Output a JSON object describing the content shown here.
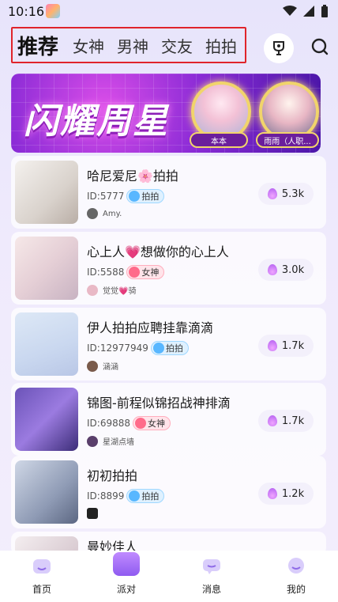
{
  "status_bar": {
    "time": "10:16"
  },
  "tabs": [
    {
      "label": "推荐",
      "active": true
    },
    {
      "label": "女神",
      "active": false
    },
    {
      "label": "男神",
      "active": false
    },
    {
      "label": "交友",
      "active": false
    },
    {
      "label": "拍拍",
      "active": false
    }
  ],
  "banner": {
    "title": "闪耀周星",
    "stars": [
      {
        "name": "本本"
      },
      {
        "name": "雨雨（人职..."
      }
    ]
  },
  "rooms": [
    {
      "title": "哈尼爱尼🌸拍拍",
      "id": "ID:5777",
      "tag": "拍拍",
      "tag_style": "blue",
      "host": "Amy.",
      "heat": "5.3k"
    },
    {
      "title": "心上人💗想做你的心上人",
      "id": "ID:5588",
      "tag": "女神",
      "tag_style": "pink",
      "host": "觉觉💗骑",
      "heat": "3.0k"
    },
    {
      "title": "伊人拍拍应聘挂靠滴滴",
      "id": "ID:12977949",
      "tag": "拍拍",
      "tag_style": "blue",
      "host": "涵涵",
      "heat": "1.7k"
    },
    {
      "title": "锦图-前程似锦招战神排滴",
      "id": "ID:69888",
      "tag": "女神",
      "tag_style": "pink",
      "host": "星湖点墙",
      "heat": "1.7k"
    },
    {
      "title": "初初拍拍",
      "id": "ID:8899",
      "tag": "拍拍",
      "tag_style": "blue",
      "host": "",
      "heat": "1.2k"
    },
    {
      "title": "曼妙佳人",
      "id": "",
      "tag": "",
      "tag_style": "",
      "host": "",
      "heat": ""
    }
  ],
  "bottom_nav": [
    {
      "label": "首页",
      "icon": "home-icon",
      "active": false
    },
    {
      "label": "派对",
      "icon": "party-tv-icon",
      "active": true
    },
    {
      "label": "消息",
      "icon": "message-icon",
      "active": false
    },
    {
      "label": "我的",
      "icon": "profile-icon",
      "active": false
    }
  ],
  "colors": {
    "accent": "#8f5bf0",
    "highlight_box": "#e0242b",
    "banner_gold": "#f1d46b"
  }
}
